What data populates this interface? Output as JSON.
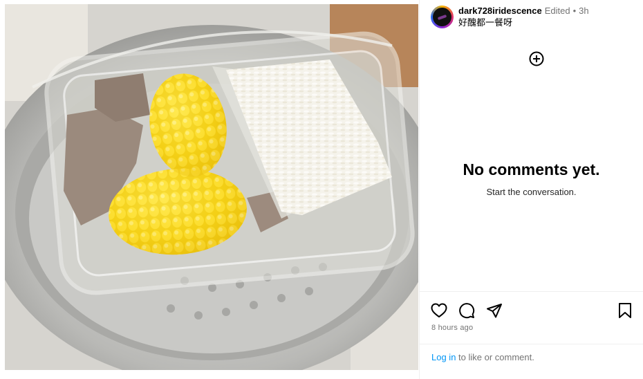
{
  "post": {
    "username": "dark728iridescence",
    "edited_label": "Edited",
    "separator": "•",
    "time": "3h",
    "caption": "好醜都一餐呀"
  },
  "comments": {
    "empty_title": "No comments yet.",
    "empty_subtitle": "Start the conversation."
  },
  "actions": {
    "like": "heart-icon",
    "comment": "comment-icon",
    "share": "share-icon",
    "save": "bookmark-icon",
    "timestamp": "8 hours ago"
  },
  "login": {
    "link_text": "Log in",
    "rest_text": " to like or comment."
  },
  "photo": {
    "alt": "Glass lunch container with pork, corn on the cob and white rice in a steel pot"
  },
  "colors": {
    "link": "#0095f6",
    "muted": "#737373"
  }
}
